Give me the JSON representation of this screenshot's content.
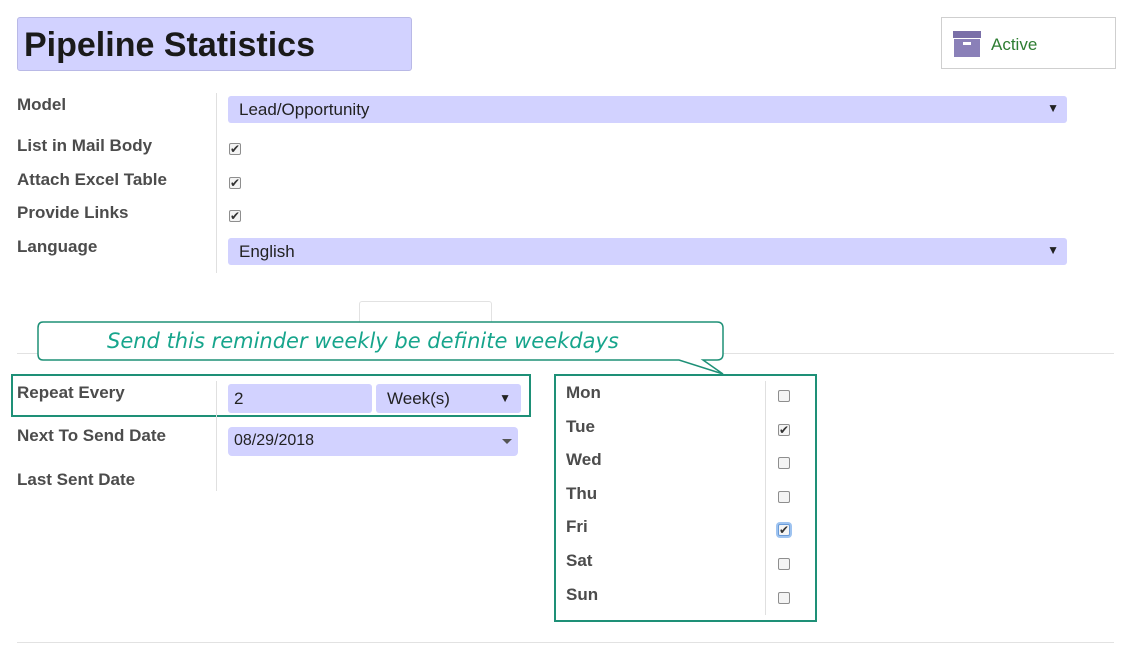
{
  "header": {
    "title": "Pipeline Statistics",
    "status_label": "Active",
    "status_color": "#2e7d32",
    "status_icon": "archive-icon"
  },
  "form": {
    "model_label": "Model",
    "model_value": "Lead/Opportunity",
    "list_in_mail_body_label": "List in Mail Body",
    "list_in_mail_body": true,
    "attach_excel_label": "Attach Excel Table",
    "attach_excel": true,
    "provide_links_label": "Provide Links",
    "provide_links": true,
    "language_label": "Language",
    "language_value": "English"
  },
  "callout": {
    "text": "Send this reminder weekly be definite weekdays"
  },
  "schedule": {
    "repeat_every_label": "Repeat Every",
    "repeat_value": "2",
    "repeat_unit": "Week(s)",
    "next_send_label": "Next To Send Date",
    "next_send_value": "08/29/2018",
    "last_sent_label": "Last Sent Date"
  },
  "weekdays": [
    {
      "label": "Mon",
      "checked": false
    },
    {
      "label": "Tue",
      "checked": true
    },
    {
      "label": "Wed",
      "checked": false
    },
    {
      "label": "Thu",
      "checked": false
    },
    {
      "label": "Fri",
      "checked": true
    },
    {
      "label": "Sat",
      "checked": false
    },
    {
      "label": "Sun",
      "checked": false
    }
  ],
  "colors": {
    "field_bg": "#d2d2ff",
    "highlight": "#1e9077",
    "callout_text": "#17a58c"
  }
}
